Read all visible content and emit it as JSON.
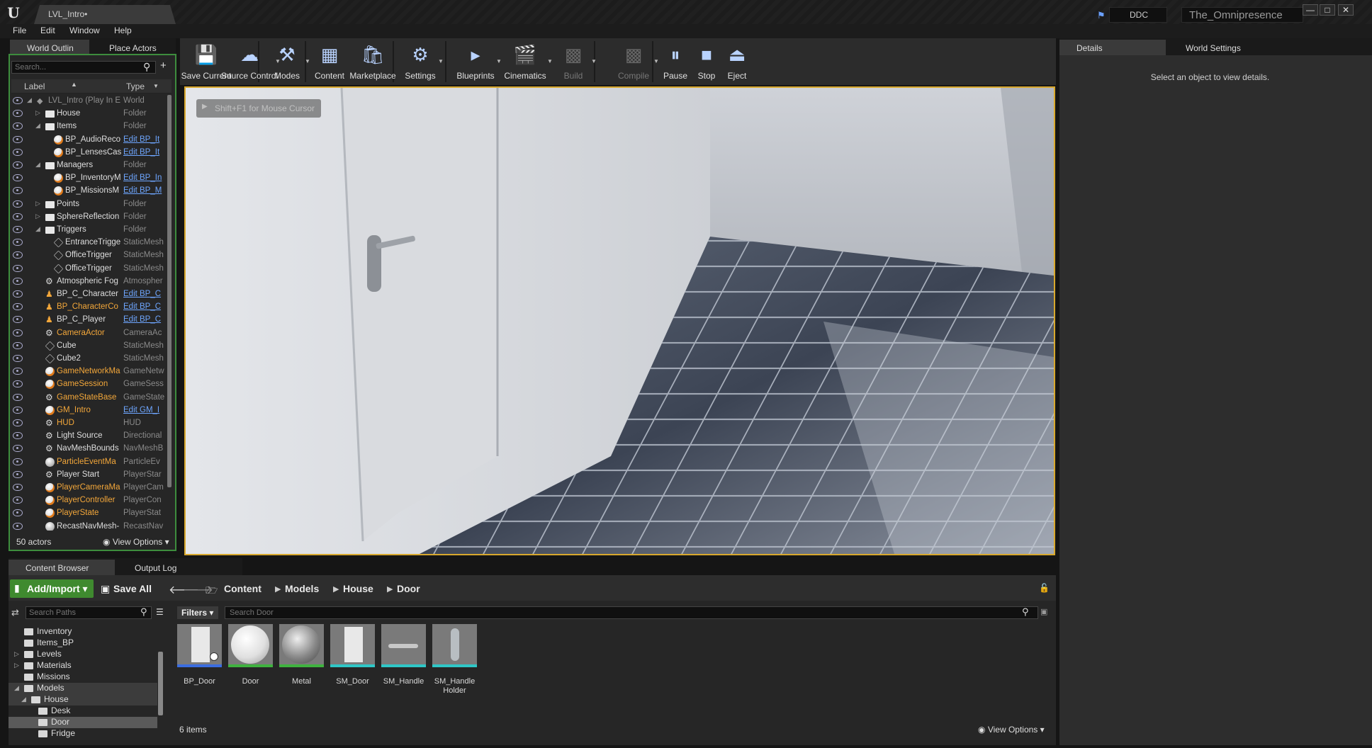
{
  "window": {
    "doc_tab": "LVL_Intro•",
    "ddc": "DDC",
    "project": "The_Omnipresence"
  },
  "menu": [
    "File",
    "Edit",
    "Window",
    "Help"
  ],
  "outliner": {
    "tabs": [
      "World Outlin",
      "Place Actors"
    ],
    "search_placeholder": "Search...",
    "col_label": "Label",
    "col_type": "Type",
    "rows": [
      {
        "label": "LVL_Intro (Play In E",
        "type": "World",
        "depth": 1,
        "icon": "world",
        "arrow": "open",
        "style": "dim",
        "link": false
      },
      {
        "label": "House",
        "type": "Folder",
        "depth": 2,
        "icon": "folder",
        "arrow": "closed",
        "style": "",
        "link": false
      },
      {
        "label": "Items",
        "type": "Folder",
        "depth": 2,
        "icon": "folder",
        "arrow": "open",
        "style": "",
        "link": false
      },
      {
        "label": "BP_AudioReco",
        "type": "Edit BP_It",
        "depth": 3,
        "icon": "ballorange",
        "arrow": "",
        "style": "",
        "link": true
      },
      {
        "label": "BP_LensesCas",
        "type": "Edit BP_It",
        "depth": 3,
        "icon": "ballorange",
        "arrow": "",
        "style": "",
        "link": true
      },
      {
        "label": "Managers",
        "type": "Folder",
        "depth": 2,
        "icon": "folder",
        "arrow": "open",
        "style": "",
        "link": false
      },
      {
        "label": "BP_InventoryM",
        "type": "Edit BP_In",
        "depth": 3,
        "icon": "ballorange",
        "arrow": "",
        "style": "",
        "link": true
      },
      {
        "label": "BP_MissionsM",
        "type": "Edit BP_M",
        "depth": 3,
        "icon": "ballorange",
        "arrow": "",
        "style": "",
        "link": true
      },
      {
        "label": "Points",
        "type": "Folder",
        "depth": 2,
        "icon": "folder",
        "arrow": "closed",
        "style": "",
        "link": false
      },
      {
        "label": "SphereReflection",
        "type": "Folder",
        "depth": 2,
        "icon": "folder",
        "arrow": "closed",
        "style": "",
        "link": false
      },
      {
        "label": "Triggers",
        "type": "Folder",
        "depth": 2,
        "icon": "folder",
        "arrow": "open",
        "style": "",
        "link": false
      },
      {
        "label": "EntranceTrigge",
        "type": "StaticMesh",
        "depth": 3,
        "icon": "mesh",
        "arrow": "",
        "style": "",
        "link": false
      },
      {
        "label": "OfficeTrigger",
        "type": "StaticMesh",
        "depth": 3,
        "icon": "mesh",
        "arrow": "",
        "style": "",
        "link": false
      },
      {
        "label": "OfficeTrigger",
        "type": "StaticMesh",
        "depth": 3,
        "icon": "mesh",
        "arrow": "",
        "style": "",
        "link": false
      },
      {
        "label": "Atmospheric Fog",
        "type": "Atmospher",
        "depth": 2,
        "icon": "gear",
        "arrow": "",
        "style": "",
        "link": false
      },
      {
        "label": "BP_C_Character",
        "type": "Edit BP_C",
        "depth": 2,
        "icon": "person",
        "arrow": "",
        "style": "",
        "link": true
      },
      {
        "label": "BP_CharacterCo",
        "type": "Edit BP_C",
        "depth": 2,
        "icon": "person",
        "arrow": "",
        "style": "orange",
        "link": true
      },
      {
        "label": "BP_C_Player",
        "type": "Edit BP_C",
        "depth": 2,
        "icon": "person",
        "arrow": "",
        "style": "",
        "link": true
      },
      {
        "label": "CameraActor",
        "type": "CameraAc",
        "depth": 2,
        "icon": "gear",
        "arrow": "",
        "style": "orange",
        "link": false
      },
      {
        "label": "Cube",
        "type": "StaticMesh",
        "depth": 2,
        "icon": "mesh",
        "arrow": "",
        "style": "",
        "link": false
      },
      {
        "label": "Cube2",
        "type": "StaticMesh",
        "depth": 2,
        "icon": "mesh",
        "arrow": "",
        "style": "",
        "link": false
      },
      {
        "label": "GameNetworkMa",
        "type": "GameNetw",
        "depth": 2,
        "icon": "ballorange",
        "arrow": "",
        "style": "orange",
        "link": false
      },
      {
        "label": "GameSession",
        "type": "GameSess",
        "depth": 2,
        "icon": "ballorange",
        "arrow": "",
        "style": "orange",
        "link": false
      },
      {
        "label": "GameStateBase",
        "type": "GameState",
        "depth": 2,
        "icon": "gear",
        "arrow": "",
        "style": "orange",
        "link": false
      },
      {
        "label": "GM_Intro",
        "type": "Edit GM_I",
        "depth": 2,
        "icon": "ballorange",
        "arrow": "",
        "style": "orange",
        "link": true
      },
      {
        "label": "HUD",
        "type": "HUD",
        "depth": 2,
        "icon": "gear",
        "arrow": "",
        "style": "orange",
        "link": false
      },
      {
        "label": "Light Source",
        "type": "Directional",
        "depth": 2,
        "icon": "gear",
        "arrow": "",
        "style": "",
        "link": false
      },
      {
        "label": "NavMeshBounds",
        "type": "NavMeshB",
        "depth": 2,
        "icon": "gear",
        "arrow": "",
        "style": "",
        "link": false
      },
      {
        "label": "ParticleEventMa",
        "type": "ParticleEv",
        "depth": 2,
        "icon": "ball",
        "arrow": "",
        "style": "orange",
        "link": false
      },
      {
        "label": "Player Start",
        "type": "PlayerStar",
        "depth": 2,
        "icon": "gear",
        "arrow": "",
        "style": "",
        "link": false
      },
      {
        "label": "PlayerCameraMa",
        "type": "PlayerCam",
        "depth": 2,
        "icon": "ballorange",
        "arrow": "",
        "style": "orange",
        "link": false
      },
      {
        "label": "PlayerController",
        "type": "PlayerCon",
        "depth": 2,
        "icon": "ballorange",
        "arrow": "",
        "style": "orange",
        "link": false
      },
      {
        "label": "PlayerState",
        "type": "PlayerStat",
        "depth": 2,
        "icon": "ballorange",
        "arrow": "",
        "style": "orange",
        "link": false
      },
      {
        "label": "RecastNavMesh-",
        "type": "RecastNav",
        "depth": 2,
        "icon": "ball",
        "arrow": "",
        "style": "",
        "link": false
      }
    ],
    "actors_count": "50 actors",
    "view_options": "View Options"
  },
  "toolbar": {
    "items": [
      {
        "label": "Save Current",
        "icon": "save-icon",
        "disabled": false,
        "dropdown": false
      },
      {
        "label": "Source Control",
        "icon": "source-control-icon",
        "disabled": false,
        "dropdown": true
      },
      {
        "label": "Modes",
        "icon": "modes-icon",
        "disabled": false,
        "dropdown": true
      },
      {
        "label": "Content",
        "icon": "content-icon",
        "disabled": false,
        "dropdown": false
      },
      {
        "label": "Marketplace",
        "icon": "marketplace-icon",
        "disabled": false,
        "dropdown": false
      },
      {
        "label": "Settings",
        "icon": "settings-icon",
        "disabled": false,
        "dropdown": true
      },
      {
        "label": "Blueprints",
        "icon": "blueprints-icon",
        "disabled": false,
        "dropdown": true
      },
      {
        "label": "Cinematics",
        "icon": "cinematics-icon",
        "disabled": false,
        "dropdown": true
      },
      {
        "label": "Build",
        "icon": "build-icon",
        "disabled": true,
        "dropdown": true
      },
      {
        "label": "Compile",
        "icon": "compile-icon",
        "disabled": true,
        "dropdown": true
      },
      {
        "label": "Pause",
        "icon": "pause-icon",
        "disabled": false,
        "dropdown": false
      },
      {
        "label": "Stop",
        "icon": "stop-icon",
        "disabled": false,
        "dropdown": false
      },
      {
        "label": "Eject",
        "icon": "eject-icon",
        "disabled": false,
        "dropdown": false
      }
    ]
  },
  "viewport": {
    "hint": "Shift+F1 for Mouse Cursor"
  },
  "details": {
    "tabs": [
      "Details",
      "World Settings"
    ],
    "empty_text": "Select an object to view details."
  },
  "bottom": {
    "tabs": [
      "Content Browser",
      "Output Log"
    ],
    "add_import": "Add/Import",
    "save_all": "Save All",
    "breadcrumb": [
      "Content",
      "Models",
      "House",
      "Door"
    ],
    "paths_placeholder": "Search Paths",
    "filters": "Filters",
    "search_placeholder": "Search Door",
    "folders": [
      {
        "name": "Inventory",
        "depth": 1,
        "arrow": ""
      },
      {
        "name": "Items_BP",
        "depth": 1,
        "arrow": ""
      },
      {
        "name": "Levels",
        "depth": 1,
        "arrow": "closed"
      },
      {
        "name": "Materials",
        "depth": 1,
        "arrow": "closed"
      },
      {
        "name": "Missions",
        "depth": 1,
        "arrow": ""
      },
      {
        "name": "Models",
        "depth": 1,
        "arrow": "open"
      },
      {
        "name": "House",
        "depth": 2,
        "arrow": "open"
      },
      {
        "name": "Desk",
        "depth": 3,
        "arrow": ""
      },
      {
        "name": "Door",
        "depth": 3,
        "arrow": "",
        "selected": true
      },
      {
        "name": "Fridge",
        "depth": 3,
        "arrow": ""
      }
    ],
    "assets": [
      {
        "name": "BP_Door",
        "bar": "#3a6de0",
        "kind": "door-bp"
      },
      {
        "name": "Door",
        "bar": "#3fb23f",
        "kind": "white-sphere"
      },
      {
        "name": "Metal",
        "bar": "#3fb23f",
        "kind": "metal-sphere"
      },
      {
        "name": "SM_Door",
        "bar": "#2fc7c7",
        "kind": "door"
      },
      {
        "name": "SM_Handle",
        "bar": "#2fc7c7",
        "kind": "handle"
      },
      {
        "name": "SM_Handle Holder",
        "bar": "#2fc7c7",
        "kind": "holder"
      }
    ],
    "items_count": "6 items",
    "view_options": "View Options"
  }
}
